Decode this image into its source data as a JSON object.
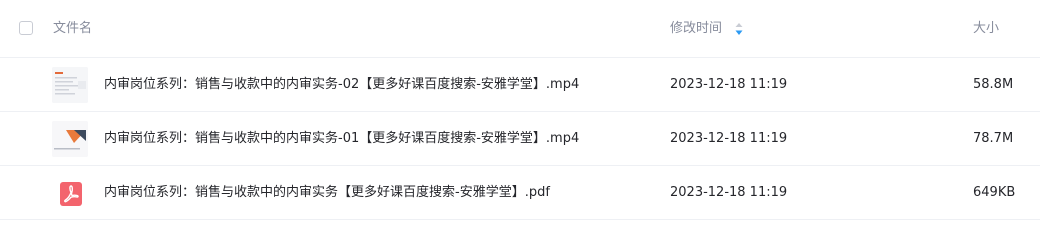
{
  "header": {
    "name_label": "文件名",
    "time_label": "修改时间",
    "size_label": "大小"
  },
  "files": [
    {
      "name": "内审岗位系列：销售与收款中的内审实务-02【更多好课百度搜索-安雅学堂】.mp4",
      "modified": "2023-12-18 11:19",
      "size": "58.8M",
      "icon": "video-thumbnail"
    },
    {
      "name": "内审岗位系列：销售与收款中的内审实务-01【更多好课百度搜索-安雅学堂】.mp4",
      "modified": "2023-12-18 11:19",
      "size": "78.7M",
      "icon": "video-thumbnail"
    },
    {
      "name": "内审岗位系列：销售与收款中的内审实务【更多好课百度搜索-安雅学堂】.pdf",
      "modified": "2023-12-18 11:19",
      "size": "649KB",
      "icon": "pdf-icon"
    }
  ],
  "colors": {
    "header_text": "#878c9c",
    "row_text": "#25262b",
    "divider": "#eef0f4",
    "sort_accent": "#2b9af3",
    "pdf_red": "#f3646d"
  }
}
